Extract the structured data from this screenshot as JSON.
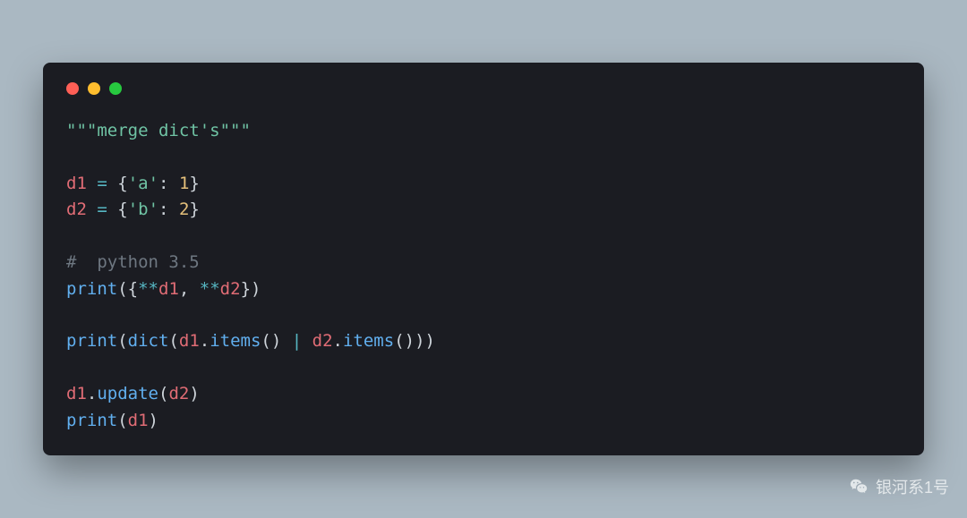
{
  "code": {
    "docstring": "\"\"\"merge dict's\"\"\"",
    "d1_name": "d1",
    "d2_name": "d2",
    "assign": "=",
    "brace_open": "{",
    "brace_close": "}",
    "bracket_open": "(",
    "bracket_close": ")",
    "key_a": "'a'",
    "key_b": "'b'",
    "colon": ":",
    "val_1": "1",
    "val_2": "2",
    "comment": "#  python 3.5",
    "print": "print",
    "dict": "dict",
    "star2": "**",
    "comma": ", ",
    "pipe": " | ",
    "dot": ".",
    "items": "items",
    "update": "update",
    "empty_call": "()"
  },
  "watermark": {
    "text": "银河系1号"
  },
  "colors": {
    "page_bg": "#AAB8C2",
    "window_bg": "#1B1C22",
    "traffic_red": "#FF5F56",
    "traffic_yellow": "#FFBD2E",
    "traffic_green": "#27C93F"
  }
}
